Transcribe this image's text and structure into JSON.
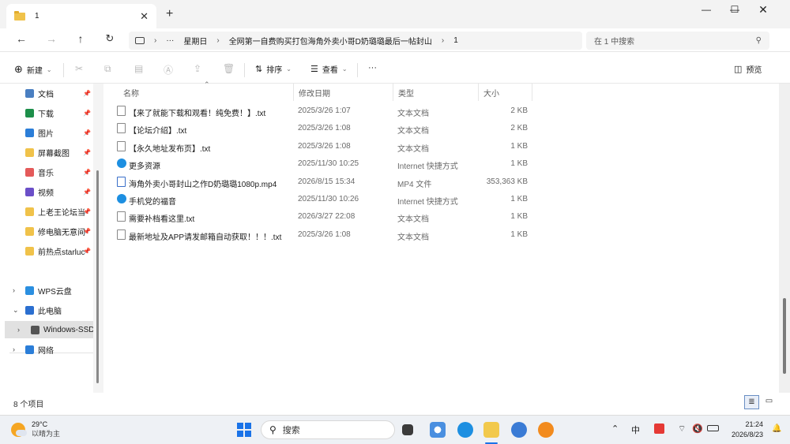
{
  "tab": {
    "title": "1"
  },
  "address": {
    "crumbs": [
      "星期日",
      "全网第一自费购买打包海角外卖小哥D奶璐璐最后一帖封山",
      "1"
    ],
    "more": "···"
  },
  "search": {
    "placeholder": "在 1 中搜索"
  },
  "toolbar": {
    "new_label": "新建",
    "sort_label": "排序",
    "view_label": "查看",
    "more_label": "···",
    "preview_label": "预览"
  },
  "sidebar": {
    "items": [
      {
        "label": "文档",
        "icon": "document-icon"
      },
      {
        "label": "下载",
        "icon": "download-icon"
      },
      {
        "label": "图片",
        "icon": "picture-icon"
      },
      {
        "label": "屏幕截图",
        "icon": "folder-icon"
      },
      {
        "label": "音乐",
        "icon": "music-icon"
      },
      {
        "label": "视频",
        "icon": "video-icon"
      },
      {
        "label": "上老王论坛当",
        "icon": "folder-icon"
      },
      {
        "label": "修电脑无意间",
        "icon": "folder-icon"
      },
      {
        "label": "前热点starluc",
        "icon": "folder-icon"
      }
    ],
    "tree": [
      {
        "label": "WPS云盘",
        "icon": "cloud-icon"
      },
      {
        "label": "此电脑",
        "icon": "computer-icon"
      },
      {
        "label": "Windows-SSD",
        "icon": "drive-icon"
      },
      {
        "label": "网络",
        "icon": "network-icon"
      }
    ]
  },
  "columns": {
    "name": "名称",
    "modified": "修改日期",
    "type": "类型",
    "size": "大小"
  },
  "files": [
    {
      "name": "【来了就能下载和观看！纯免费！】.txt",
      "modified": "2025/3/26 1:07",
      "type": "文本文档",
      "size": "2 KB",
      "icon": "text-file-icon"
    },
    {
      "name": "【论坛介绍】.txt",
      "modified": "2025/3/26 1:08",
      "type": "文本文档",
      "size": "2 KB",
      "icon": "text-file-icon"
    },
    {
      "name": "【永久地址发布页】.txt",
      "modified": "2025/3/26 1:08",
      "type": "文本文档",
      "size": "1 KB",
      "icon": "text-file-icon"
    },
    {
      "name": "更多资源",
      "modified": "2025/11/30 10:25",
      "type": "Internet 快捷方式",
      "size": "1 KB",
      "icon": "browser-shortcut-icon"
    },
    {
      "name": "海角外卖小哥封山之作D奶璐璐1080p.mp4",
      "modified": "2026/8/15 15:34",
      "type": "MP4 文件",
      "size": "353,363 KB",
      "icon": "video-file-icon"
    },
    {
      "name": "手机党的福音",
      "modified": "2025/11/30 10:26",
      "type": "Internet 快捷方式",
      "size": "1 KB",
      "icon": "browser-shortcut-icon"
    },
    {
      "name": "需要补档看这里.txt",
      "modified": "2026/3/27 22:08",
      "type": "文本文档",
      "size": "1 KB",
      "icon": "text-file-icon"
    },
    {
      "name": "最新地址及APP请发邮箱自动获取！！！.txt",
      "modified": "2025/3/26 1:08",
      "type": "文本文档",
      "size": "1 KB",
      "icon": "text-file-icon"
    }
  ],
  "status": {
    "count": "8 个项目"
  },
  "taskbar": {
    "weather_temp": "29°C",
    "weather_desc": "以晴为主",
    "search_label": "搜索",
    "time": "21:24",
    "date": "2026/8/23"
  }
}
